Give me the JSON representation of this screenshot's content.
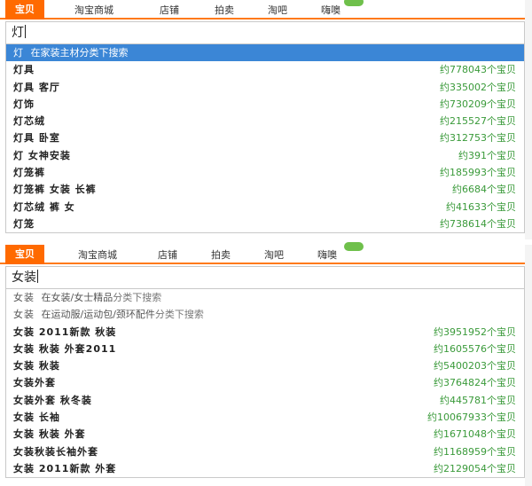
{
  "panel1": {
    "tabs": [
      {
        "label": "宝贝",
        "active": true
      },
      {
        "label": "淘宝商城",
        "active": false
      },
      {
        "label": "店铺",
        "active": false
      },
      {
        "label": "拍卖",
        "active": false
      },
      {
        "label": "淘吧",
        "active": false
      },
      {
        "label": "嗨噢",
        "active": false
      }
    ],
    "query": "灯",
    "highlight": {
      "kw": "灯",
      "hint": "在家装主材分类下搜索"
    },
    "suggestions": [
      {
        "kw": "灯具",
        "count": "约778043个宝贝"
      },
      {
        "kw": "灯具 客厅",
        "count": "约335002个宝贝"
      },
      {
        "kw": "灯饰",
        "count": "约730209个宝贝"
      },
      {
        "kw": "灯芯绒",
        "count": "约215527个宝贝"
      },
      {
        "kw": "灯具 卧室",
        "count": "约312753个宝贝"
      },
      {
        "kw": "灯 女神安装",
        "count": "约391个宝贝"
      },
      {
        "kw": "灯笼裤",
        "count": "约185993个宝贝"
      },
      {
        "kw": "灯笼裤 女装 长裤",
        "count": "约6684个宝贝"
      },
      {
        "kw": "灯芯绒 裤 女",
        "count": "约41633个宝贝"
      },
      {
        "kw": "灯笼",
        "count": "约738614个宝贝"
      }
    ]
  },
  "panel2": {
    "tabs": [
      {
        "label": "宝贝",
        "active": true
      },
      {
        "label": "淘宝商城",
        "active": false
      },
      {
        "label": "店铺",
        "active": false
      },
      {
        "label": "拍卖",
        "active": false
      },
      {
        "label": "淘吧",
        "active": false
      },
      {
        "label": "嗨噢",
        "active": false
      }
    ],
    "query": "女装",
    "category_hints": [
      {
        "kw": "女装",
        "cat": "在女装/女士精品",
        "hint": "分类下搜索"
      },
      {
        "kw": "女装",
        "cat": "在运动服/运动包/颈环配件",
        "hint": "分类下搜索"
      }
    ],
    "suggestions": [
      {
        "kw": "女装 2011新款 秋装",
        "count": "约3951952个宝贝"
      },
      {
        "kw": "女装 秋装 外套2011",
        "count": "约1605576个宝贝"
      },
      {
        "kw": "女装 秋装",
        "count": "约5400203个宝贝"
      },
      {
        "kw": "女装外套",
        "count": "约3764824个宝贝"
      },
      {
        "kw": "女装外套 秋冬装",
        "count": "约445781个宝贝"
      },
      {
        "kw": "女装 长袖",
        "count": "约10067933个宝贝"
      },
      {
        "kw": "女装 秋装 外套",
        "count": "约1671048个宝贝"
      },
      {
        "kw": "女装秋装长袖外套",
        "count": "约1168959个宝贝"
      },
      {
        "kw": "女装 2011新款 外套",
        "count": "约2129054个宝贝"
      }
    ]
  }
}
